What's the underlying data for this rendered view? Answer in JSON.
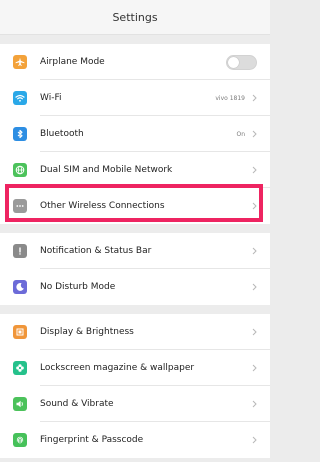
{
  "header": {
    "title": "Settings"
  },
  "colors": {
    "highlight": "#ee2461",
    "airplane": "#f3a23a",
    "wifi": "#2aa8e8",
    "bluetooth": "#2d8ee3",
    "network": "#4cc25b",
    "other": "#9a9a9a",
    "notification": "#8a8a8a",
    "no_disturb": "#6c6bd8",
    "display": "#f0963a",
    "lockscreen": "#25c18b",
    "sound": "#4cc25b",
    "fingerprint": "#46c15a"
  },
  "groups": [
    {
      "items": [
        {
          "label": "Airplane Mode",
          "icon": "airplane-icon",
          "control": "toggle",
          "toggle_on": false
        },
        {
          "label": "Wi-Fi",
          "icon": "wifi-icon",
          "value": "vivo 1819"
        },
        {
          "label": "Bluetooth",
          "icon": "bluetooth-icon",
          "value": "On"
        },
        {
          "label": "Dual SIM and Mobile Network",
          "icon": "globe-icon"
        },
        {
          "label": "Other Wireless Connections",
          "icon": "more-dots-icon"
        }
      ]
    },
    {
      "items": [
        {
          "label": "Notification & Status Bar",
          "icon": "notification-icon"
        },
        {
          "label": "No Disturb Mode",
          "icon": "moon-icon"
        }
      ]
    },
    {
      "items": [
        {
          "label": "Display & Brightness",
          "icon": "display-icon"
        },
        {
          "label": "Lockscreen magazine & wallpaper",
          "icon": "flower-icon"
        },
        {
          "label": "Sound & Vibrate",
          "icon": "speaker-icon"
        },
        {
          "label": "Fingerprint & Passcode",
          "icon": "fingerprint-icon"
        }
      ]
    }
  ]
}
